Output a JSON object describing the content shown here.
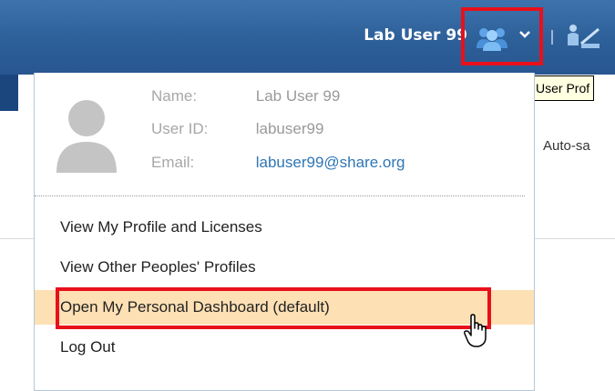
{
  "header": {
    "username": "Lab User 99",
    "user_menu_icon": "users-icon",
    "chevron_icon": "chevron-down-icon",
    "tool_icon": "dashboard-tool-icon"
  },
  "tooltip": {
    "text": "User Prof"
  },
  "background": {
    "autosave_text": "Auto-sa"
  },
  "profile": {
    "avatar_icon": "avatar-placeholder-icon",
    "name_label": "Name:",
    "name_value": "Lab User 99",
    "userid_label": "User ID:",
    "userid_value": "labuser99",
    "email_label": "Email:",
    "email_value": "labuser99@share.org"
  },
  "menu": {
    "items": [
      {
        "label": "View My Profile and Licenses"
      },
      {
        "label": "View Other Peoples' Profiles"
      },
      {
        "label": "Open My Personal Dashboard (default)"
      },
      {
        "label": "Log Out"
      }
    ]
  },
  "colors": {
    "header_blue": "#2d5f98",
    "highlight_red": "#e8101a",
    "hover_orange": "#fde0b4",
    "link_blue": "#2f76b6"
  }
}
